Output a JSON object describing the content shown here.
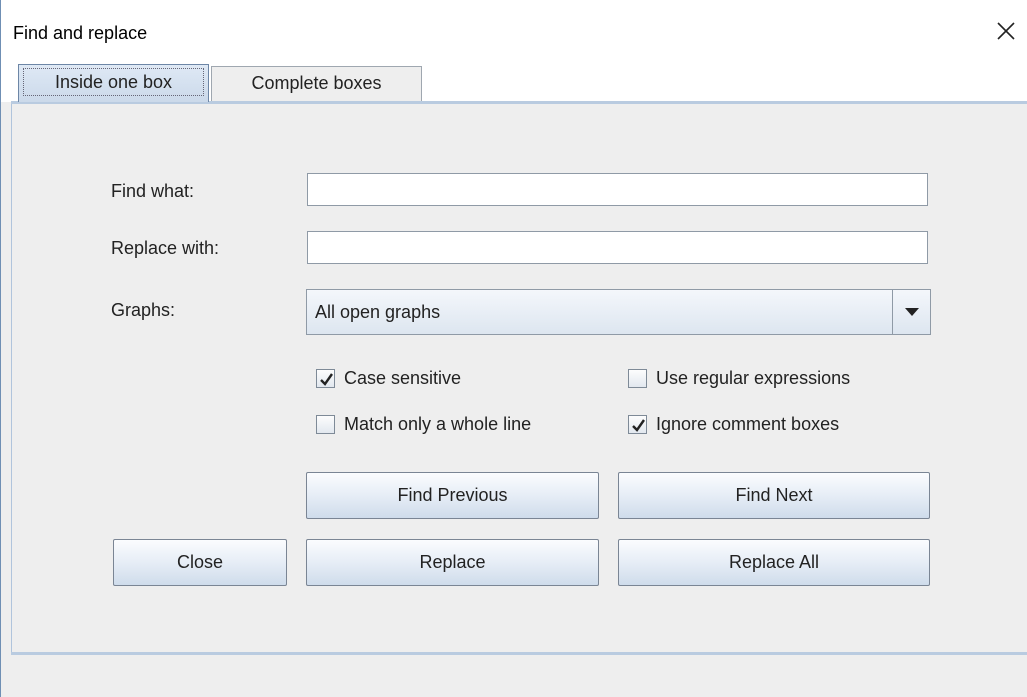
{
  "window": {
    "title": "Find and replace",
    "close_icon": "close-icon"
  },
  "tabs": [
    {
      "label": "Inside one box",
      "active": true
    },
    {
      "label": "Complete boxes",
      "active": false
    }
  ],
  "form": {
    "find_label": "Find what:",
    "find_value": "",
    "replace_label": "Replace with:",
    "replace_value": "",
    "graphs_label": "Graphs:",
    "graphs_selected": "All open graphs"
  },
  "options": {
    "case_sensitive": {
      "label": "Case sensitive",
      "checked": true
    },
    "use_regex": {
      "label": "Use regular expressions",
      "checked": false
    },
    "whole_line": {
      "label": "Match only a whole line",
      "checked": false
    },
    "ignore_comments": {
      "label": "Ignore comment boxes",
      "checked": true
    }
  },
  "buttons": {
    "find_previous": "Find Previous",
    "find_next": "Find Next",
    "close": "Close",
    "replace": "Replace",
    "replace_all": "Replace All"
  },
  "colors": {
    "accent_border": "#6f8fb4",
    "background": "#eeeeee"
  }
}
